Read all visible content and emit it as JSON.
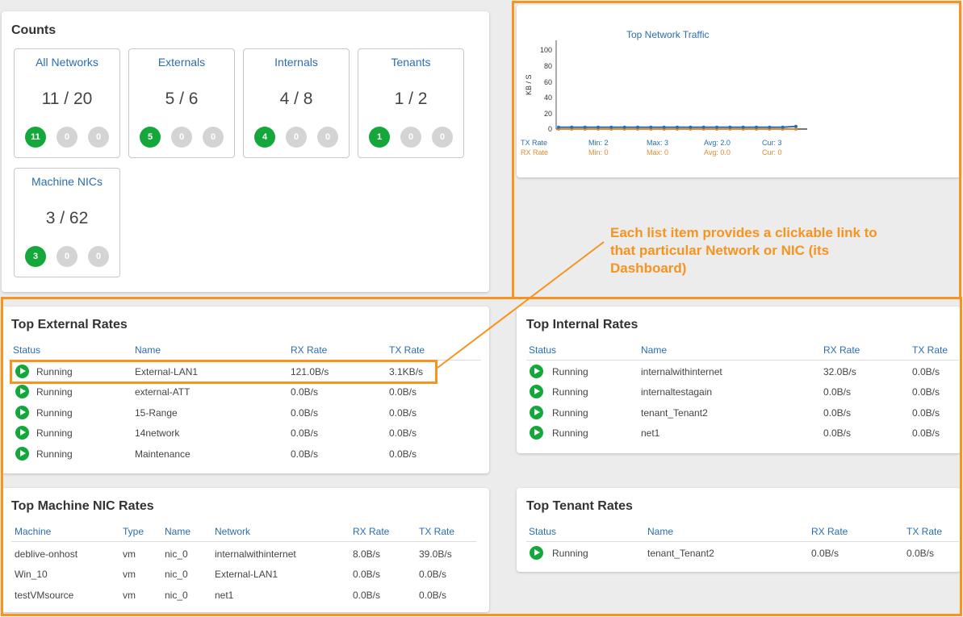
{
  "counts": {
    "title": "Counts",
    "cards": [
      {
        "label": "All Networks",
        "value": "11 / 20",
        "badges": [
          "11",
          "0",
          "0"
        ]
      },
      {
        "label": "Externals",
        "value": "5 / 6",
        "badges": [
          "5",
          "0",
          "0"
        ]
      },
      {
        "label": "Internals",
        "value": "4 / 8",
        "badges": [
          "4",
          "0",
          "0"
        ]
      },
      {
        "label": "Tenants",
        "value": "1 / 2",
        "badges": [
          "1",
          "0",
          "0"
        ]
      },
      {
        "label": "Machine NICs",
        "value": "3 / 62",
        "badges": [
          "3",
          "0",
          "0"
        ]
      }
    ]
  },
  "traffic_chart": {
    "title": "Top Network Traffic",
    "ylabel": "KB / S",
    "yticks": [
      "100",
      "80",
      "60",
      "40",
      "20",
      "0"
    ],
    "legend": [
      {
        "name": "TX Rate",
        "min": "Min: 2",
        "max": "Max: 3",
        "avg": "Avg: 2.0",
        "cur": "Cur: 3"
      },
      {
        "name": "RX Rate",
        "min": "Min: 0",
        "max": "Max: 0",
        "avg": "Avg: 0.0",
        "cur": "Cur: 0"
      }
    ]
  },
  "chart_data": {
    "type": "line",
    "title": "Top Network Traffic",
    "ylabel": "KB / S",
    "ylim": [
      0,
      100
    ],
    "series": [
      {
        "name": "TX Rate",
        "values": [
          2,
          2,
          2,
          2,
          2,
          2,
          2,
          2,
          2,
          2,
          2,
          2,
          2,
          2,
          2,
          2,
          2,
          2,
          3
        ]
      },
      {
        "name": "RX Rate",
        "values": [
          0,
          0,
          0,
          0,
          0,
          0,
          0,
          0,
          0,
          0,
          0,
          0,
          0,
          0,
          0,
          0,
          0,
          0,
          0
        ]
      }
    ]
  },
  "external_rates": {
    "title": "Top External Rates",
    "headers": [
      "Status",
      "Name",
      "RX Rate",
      "TX Rate"
    ],
    "rows": [
      {
        "status": "Running",
        "name": "External-LAN1",
        "rx": "121.0B/s",
        "tx": "3.1KB/s"
      },
      {
        "status": "Running",
        "name": "external-ATT",
        "rx": "0.0B/s",
        "tx": "0.0B/s"
      },
      {
        "status": "Running",
        "name": "15-Range",
        "rx": "0.0B/s",
        "tx": "0.0B/s"
      },
      {
        "status": "Running",
        "name": "14network",
        "rx": "0.0B/s",
        "tx": "0.0B/s"
      },
      {
        "status": "Running",
        "name": "Maintenance",
        "rx": "0.0B/s",
        "tx": "0.0B/s"
      }
    ]
  },
  "internal_rates": {
    "title": "Top Internal Rates",
    "headers": [
      "Status",
      "Name",
      "RX Rate",
      "TX Rate"
    ],
    "rows": [
      {
        "status": "Running",
        "name": "internalwithinternet",
        "rx": "32.0B/s",
        "tx": "0.0B/s"
      },
      {
        "status": "Running",
        "name": "internaltestagain",
        "rx": "0.0B/s",
        "tx": "0.0B/s"
      },
      {
        "status": "Running",
        "name": "tenant_Tenant2",
        "rx": "0.0B/s",
        "tx": "0.0B/s"
      },
      {
        "status": "Running",
        "name": "net1",
        "rx": "0.0B/s",
        "tx": "0.0B/s"
      }
    ]
  },
  "machine_nic_rates": {
    "title": "Top Machine NIC Rates",
    "headers": [
      "Machine",
      "Type",
      "Name",
      "Network",
      "RX Rate",
      "TX Rate"
    ],
    "rows": [
      {
        "machine": "deblive-onhost",
        "type": "vm",
        "name": "nic_0",
        "network": "internalwithinternet",
        "rx": "8.0B/s",
        "tx": "39.0B/s"
      },
      {
        "machine": "Win_10",
        "type": "vm",
        "name": "nic_0",
        "network": "External-LAN1",
        "rx": "0.0B/s",
        "tx": "0.0B/s"
      },
      {
        "machine": "testVMsource",
        "type": "vm",
        "name": "nic_0",
        "network": "net1",
        "rx": "0.0B/s",
        "tx": "0.0B/s"
      }
    ]
  },
  "tenant_rates": {
    "title": "Top Tenant Rates",
    "headers": [
      "Status",
      "Name",
      "RX Rate",
      "TX Rate"
    ],
    "rows": [
      {
        "status": "Running",
        "name": "tenant_Tenant2",
        "rx": "0.0B/s",
        "tx": "0.0B/s"
      }
    ]
  },
  "annotation": {
    "text": "Each list item provides a clickable link to that particular Network or NIC (its Dashboard)",
    "color": "#f7931e"
  },
  "colors": {
    "link": "#2a6db0",
    "running": "#14a83b",
    "tx_series": "#2a6db0",
    "rx_series": "#e48a2e"
  }
}
